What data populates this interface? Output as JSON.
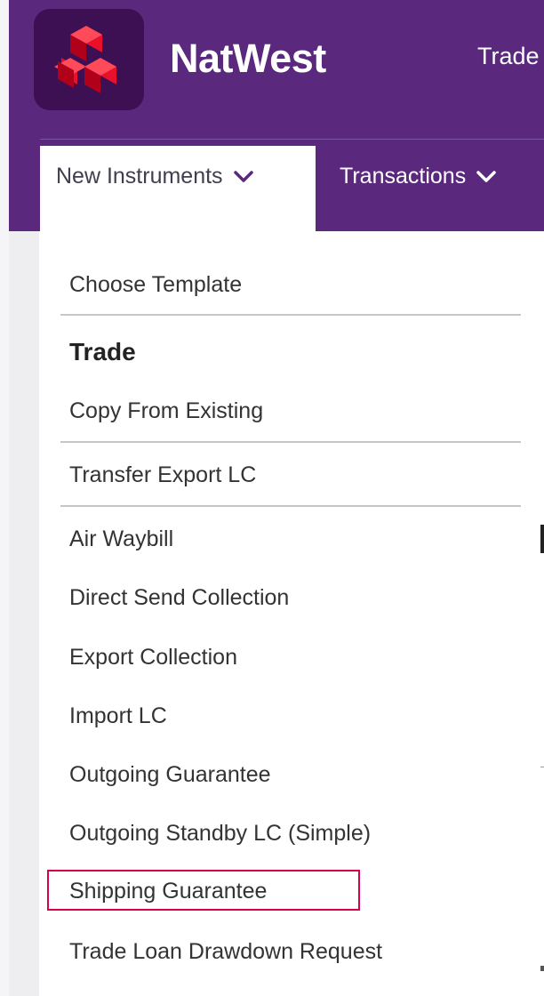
{
  "brand": {
    "name": "NatWest",
    "colors": {
      "header_purple": "#5a287d",
      "logo_bg": "#3c1053",
      "logo_red": "#e8102b",
      "highlight": "#d6004d"
    }
  },
  "header": {
    "top_link": "Trade"
  },
  "nav": {
    "tabs": [
      {
        "label": "New Instruments",
        "icon": "chevron-down-icon",
        "active": true
      },
      {
        "label": "Transactions",
        "icon": "chevron-down-icon",
        "active": false
      }
    ]
  },
  "dropdown": {
    "choose_template": "Choose Template",
    "heading": "Trade",
    "copy_from_existing": "Copy From Existing",
    "transfer_export_lc": "Transfer Export LC",
    "items": [
      "Air Waybill",
      "Direct Send Collection",
      "Export Collection",
      "Import LC",
      "Outgoing Guarantee",
      "Outgoing Standby LC (Simple)",
      "Shipping Guarantee",
      "Trade Loan Drawdown Request"
    ],
    "highlighted_item": "Shipping Guarantee"
  }
}
